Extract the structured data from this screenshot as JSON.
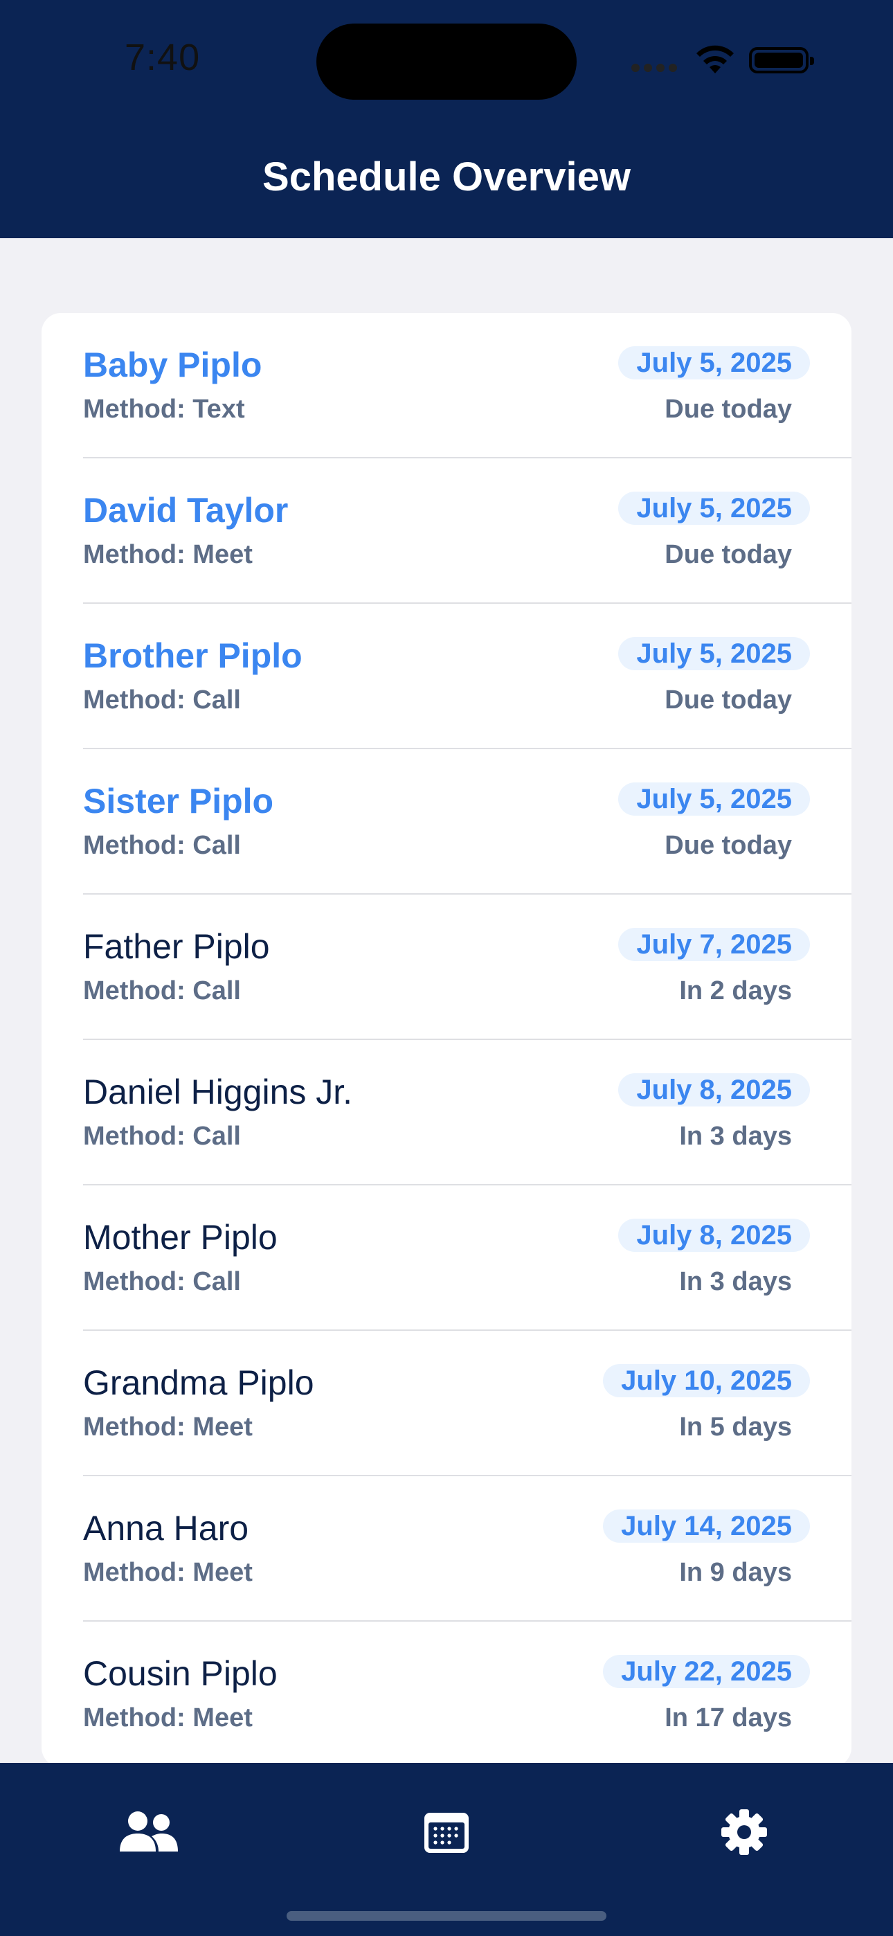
{
  "status_bar": {
    "time": "7:40"
  },
  "header": {
    "title": "Schedule Overview"
  },
  "schedule": [
    {
      "name": "Baby Piplo",
      "method": "Method: Text",
      "date": "July 5, 2025",
      "relative": "Due today",
      "due": true
    },
    {
      "name": "David Taylor",
      "method": "Method: Meet",
      "date": "July 5, 2025",
      "relative": "Due today",
      "due": true
    },
    {
      "name": "Brother Piplo",
      "method": "Method: Call",
      "date": "July 5, 2025",
      "relative": "Due today",
      "due": true
    },
    {
      "name": "Sister Piplo",
      "method": "Method: Call",
      "date": "July 5, 2025",
      "relative": "Due today",
      "due": true
    },
    {
      "name": "Father Piplo",
      "method": "Method: Call",
      "date": "July 7, 2025",
      "relative": "In 2 days",
      "due": false
    },
    {
      "name": "Daniel Higgins Jr.",
      "method": "Method: Call",
      "date": "July 8, 2025",
      "relative": "In 3 days",
      "due": false
    },
    {
      "name": "Mother Piplo",
      "method": "Method: Call",
      "date": "July 8, 2025",
      "relative": "In 3 days",
      "due": false
    },
    {
      "name": "Grandma Piplo",
      "method": "Method: Meet",
      "date": "July 10, 2025",
      "relative": "In 5 days",
      "due": false
    },
    {
      "name": "Anna Haro",
      "method": "Method: Meet",
      "date": "July 14, 2025",
      "relative": "In 9 days",
      "due": false
    },
    {
      "name": "Cousin Piplo",
      "method": "Method: Meet",
      "date": "July 22, 2025",
      "relative": "In 17 days",
      "due": false
    }
  ],
  "tabbar": {
    "items": [
      {
        "icon": "people-icon"
      },
      {
        "icon": "calendar-icon"
      },
      {
        "icon": "gear-icon"
      }
    ]
  },
  "colors": {
    "navy": "#0b2454",
    "accent": "#3b86f0",
    "muted": "#5d6d87"
  }
}
